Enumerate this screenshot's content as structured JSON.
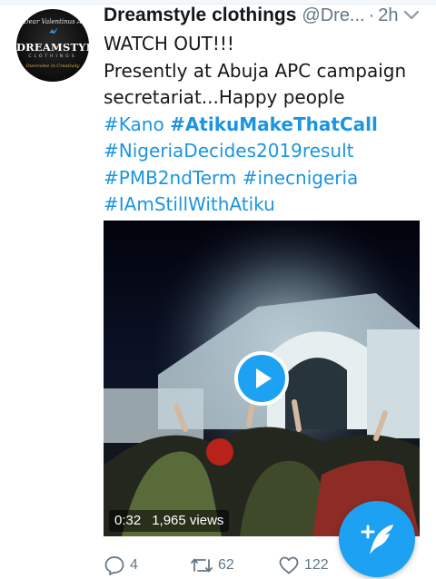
{
  "tweet": {
    "avatar": {
      "tagline": "Dear Valentinus A",
      "brand": "DREAMSTYLE",
      "sub": "CLOTHINGS",
      "motto": "Overcome in Creativity"
    },
    "display_name": "Dreamstyle clothings",
    "handle": "@Dre...",
    "separator": "·",
    "time": "2h",
    "lines": {
      "l1": "WATCH OUT!!!",
      "l2": "Presently at Abuja APC campaign",
      "l3": "secretariat...Happy people",
      "l4a": "#Kano",
      "l4b": "#AtikuMakeThatCall",
      "l5": "#NigeriaDecides2019result",
      "l6a": "#PMB2ndTerm",
      "l6b": "#inecnigeria",
      "l7": "#IAmStillWithAtiku"
    },
    "video": {
      "duration": "0:32",
      "views": "1,965 views"
    },
    "actions": {
      "replies": "4",
      "retweets": "62",
      "likes": "122"
    }
  },
  "colors": {
    "accent": "#1da1f2",
    "hashtag": "#1b95e0",
    "muted": "#657786",
    "text": "#14171a"
  },
  "icons": [
    "caret-down-icon",
    "play-icon",
    "reply-icon",
    "retweet-icon",
    "like-icon",
    "compose-tweet-icon"
  ]
}
